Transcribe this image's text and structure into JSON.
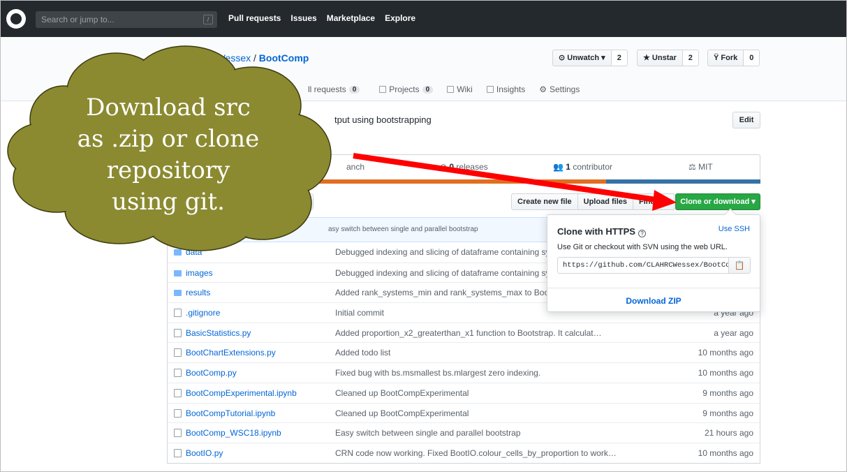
{
  "header": {
    "search_placeholder": "Search or jump to...",
    "search_shortcut": "/",
    "nav": [
      "Pull requests",
      "Issues",
      "Marketplace",
      "Explore"
    ]
  },
  "repo": {
    "owner": "CLAHRCWessex",
    "separator": "/",
    "name": "BootComp",
    "watch": {
      "label": "⊙ Unwatch ▾",
      "count": "2"
    },
    "star": {
      "label": "★ Unstar",
      "count": "2"
    },
    "fork": {
      "label": "Fork",
      "count": "0"
    },
    "tabs": [
      {
        "label": "ll requests",
        "count": "0"
      },
      {
        "label": "Projects",
        "count": "0"
      },
      {
        "label": "Wiki"
      },
      {
        "label": "Insights"
      },
      {
        "label": "Settings"
      }
    ],
    "description_fragment": "tput using bootstrapping",
    "edit_label": "Edit"
  },
  "stats": {
    "branch_fragment": "anch",
    "releases_count": "0",
    "releases_label": "releases",
    "contributors_count": "1",
    "contributors_label": "contributor",
    "license": "MIT"
  },
  "actions": {
    "create_new_file": "Create new file",
    "upload_files": "Upload files",
    "find_file": "Find file",
    "clone_or_download": "Clone or download ▾"
  },
  "latest_commit_fragment": "asy switch between single and parallel bootstrap",
  "files": [
    {
      "name": "data",
      "type": "folder",
      "message": "Debugged indexing and slicing of dataframe containing sy",
      "age": ""
    },
    {
      "name": "images",
      "type": "folder",
      "message": "Debugged indexing and slicing of dataframe containing sy",
      "age": ""
    },
    {
      "name": "results",
      "type": "folder",
      "message": "Added rank_systems_min and rank_systems_max to Boot",
      "age": ""
    },
    {
      "name": ".gitignore",
      "type": "file",
      "message": "Initial commit",
      "age": "a year ago"
    },
    {
      "name": "BasicStatistics.py",
      "type": "file",
      "message": "Added proportion_x2_greaterthan_x1 function to Bootstrap. It calculat…",
      "age": "a year ago"
    },
    {
      "name": "BootChartExtensions.py",
      "type": "file",
      "message": "Added todo list",
      "age": "10 months ago"
    },
    {
      "name": "BootComp.py",
      "type": "file",
      "message": "Fixed bug with bs.msmallest bs.mlargest zero indexing.",
      "age": "10 months ago"
    },
    {
      "name": "BootCompExperimental.ipynb",
      "type": "file",
      "message": "Cleaned up BootCompExperimental",
      "age": "9 months ago"
    },
    {
      "name": "BootCompTutorial.ipynb",
      "type": "file",
      "message": "Cleaned up BootCompExperimental",
      "age": "9 months ago"
    },
    {
      "name": "BootComp_WSC18.ipynb",
      "type": "file",
      "message": "Easy switch between single and parallel bootstrap",
      "age": "21 hours ago"
    },
    {
      "name": "BootIO.py",
      "type": "file",
      "message": "CRN code now working. Fixed BootIO.colour_cells_by_proportion to work…",
      "age": "10 months ago"
    }
  ],
  "clone_dropdown": {
    "title": "Clone with HTTPS",
    "help_glyph": "?",
    "use_ssh": "Use SSH",
    "help_text": "Use Git or checkout with SVN using the web URL.",
    "url": "https://github.com/CLAHRCWessex/BootComp.git",
    "copy_glyph": "📋",
    "download_zip": "Download ZIP"
  },
  "annotation": {
    "lines": [
      "Download src",
      "as .zip or clone",
      "repository",
      "using git."
    ],
    "cloud_color": "#8b8a31",
    "arrow_color": "#ff0000"
  }
}
